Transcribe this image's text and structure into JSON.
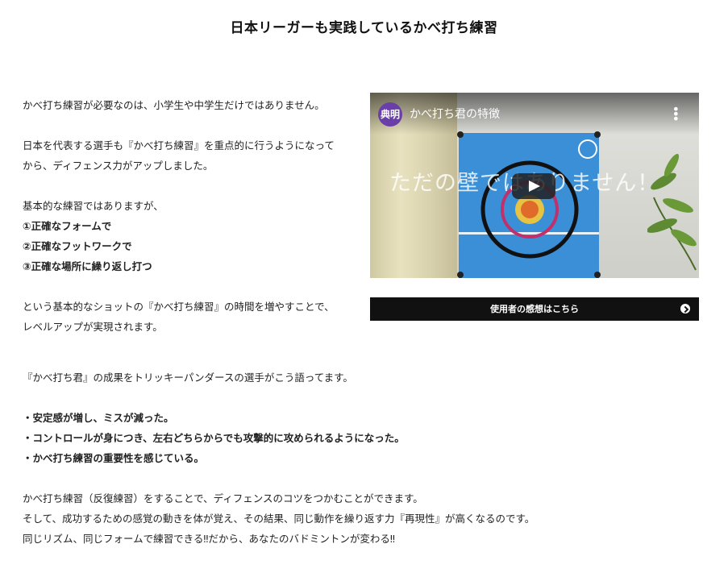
{
  "title": "日本リーガーも実践しているかべ打ち練習",
  "intro": {
    "p1": "かべ打ち練習が必要なのは、小学生や中学生だけではありません。",
    "p2a": "日本を代表する選手も『かべ打ち練習』を重点的に行うようになって",
    "p2b": "から、ディフェンス力がアップしました。",
    "p3": "基本的な練習ではありますが、",
    "points": [
      "①正確なフォームで",
      "②正確なフットワークで",
      "③正確な場所に繰り返し打つ"
    ],
    "p4a": "という基本的なショットの『かべ打ち練習』の時間を増やすことで、",
    "p4b": "レベルアップが実現されます。"
  },
  "video": {
    "channel_badge": "典明",
    "title": "かべ打ち君の特徴",
    "overlay_text": "ただの壁ではありません！"
  },
  "cta": {
    "label": "使用者の感想はこちら"
  },
  "testimonial": {
    "lead": "『かべ打ち君』の成果をトリッキーパンダースの選手がこう語ってます。",
    "bullets": [
      "・安定感が増し、ミスが減った。",
      "・コントロールが身につき、左右どちらからでも攻撃的に攻められるようになった。",
      "・かべ打ち練習の重要性を感じている。"
    ],
    "c1": "かべ打ち練習（反復練習）をすることで、ディフェンスのコツをつかむことができます。",
    "c2": "そして、成功するための感覚の動きを体が覚え、その結果、同じ動作を繰り返す力『再現性』が高くなるのです。",
    "c3": "同じリズム、同じフォームで練習できる‼だから、あなたのバドミントンが変わる‼"
  }
}
